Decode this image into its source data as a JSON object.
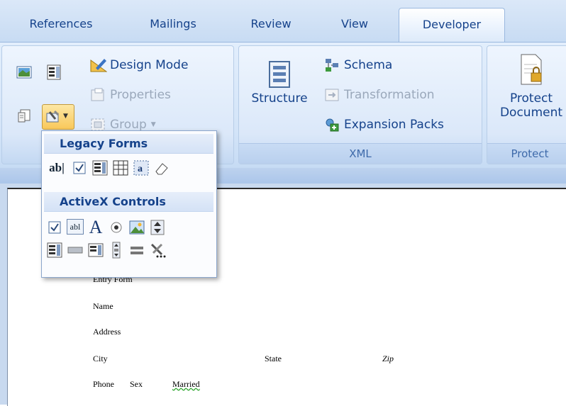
{
  "tabs": [
    {
      "label": "References"
    },
    {
      "label": "Mailings"
    },
    {
      "label": "Review"
    },
    {
      "label": "View"
    },
    {
      "label": "Developer"
    }
  ],
  "controls_group": {
    "design_mode": "Design Mode",
    "properties": "Properties",
    "group": "Group"
  },
  "xml_group": {
    "structure": "Structure",
    "schema": "Schema",
    "transformation": "Transformation",
    "expansion_packs": "Expansion Packs",
    "label": "XML"
  },
  "protect_group": {
    "button_line1": "Protect",
    "button_line2": "Document",
    "label": "Protect"
  },
  "popup": {
    "legacy_title": "Legacy Forms",
    "legacy_text_field": "ab|",
    "activex_title": "ActiveX Controls",
    "activex_textbox": "abl",
    "activex_label": "A",
    "legacy_frame": "a"
  },
  "document": {
    "title": "Entry Form",
    "name": "Name",
    "address": "Address",
    "city": "City",
    "state": "State",
    "zip": "Zip",
    "phone": "Phone",
    "sex": "Sex",
    "married": "Married"
  },
  "colors": {
    "ribbon_text": "#15428b",
    "group_label": "#3e6aaa",
    "disabled_text": "#9aa8bb"
  }
}
